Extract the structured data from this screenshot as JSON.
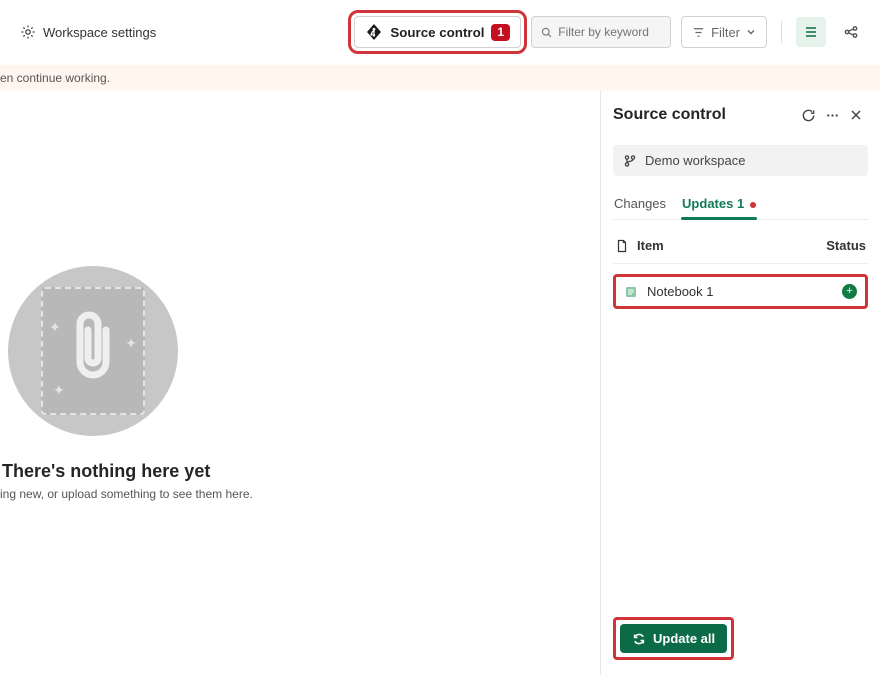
{
  "toolbar": {
    "workspace_settings": "Workspace settings",
    "source_control_label": "Source control",
    "source_control_count": "1",
    "search_placeholder": "Filter by keyword",
    "filter_label": "Filter"
  },
  "alert": {
    "text": "en continue working."
  },
  "empty_state": {
    "title": "There's nothing here yet",
    "subtitle": "ing new, or upload something to see them here."
  },
  "panel": {
    "title": "Source control",
    "workspace_name": "Demo workspace",
    "tabs": {
      "changes": "Changes",
      "updates": "Updates 1"
    },
    "columns": {
      "item": "Item",
      "status": "Status"
    },
    "rows": [
      {
        "name": "Notebook 1"
      }
    ],
    "update_all": "Update all"
  }
}
